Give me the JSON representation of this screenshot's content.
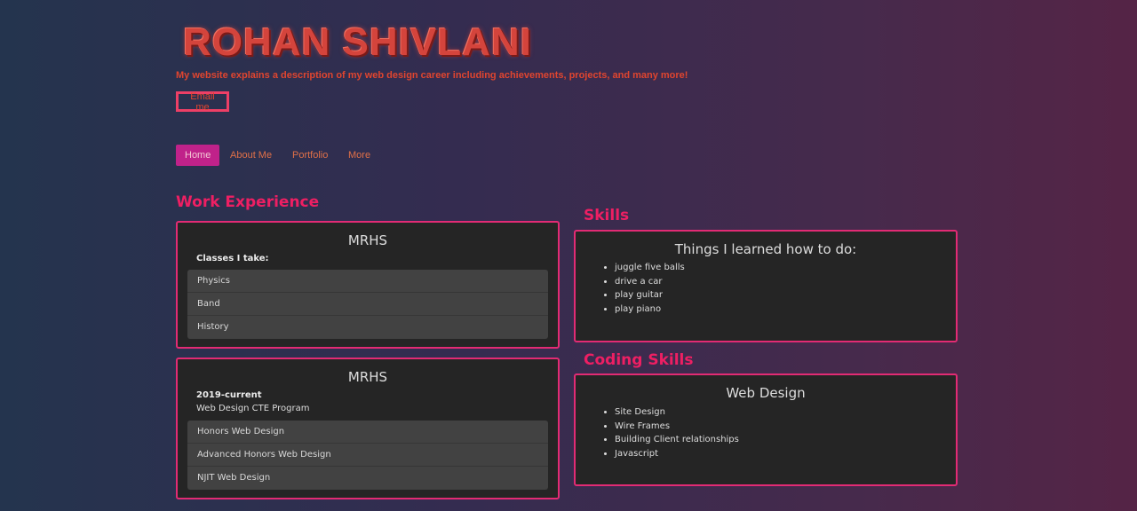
{
  "header": {
    "logo_text": "ROHAN SHIVLANI",
    "tagline": "My website explains a description of my web design career including achievements, projects, and many more!",
    "email_button": "Email me"
  },
  "nav": {
    "items": [
      {
        "label": "Home",
        "active": true
      },
      {
        "label": "About Me",
        "active": false
      },
      {
        "label": "Portfolio",
        "active": false
      },
      {
        "label": "More",
        "active": false
      }
    ]
  },
  "work_experience": {
    "title": "Work Experience",
    "cards": [
      {
        "title": "MRHS",
        "subheading": "Classes I take:",
        "items": [
          "Physics",
          "Band",
          "History"
        ]
      },
      {
        "title": "MRHS",
        "subheading": "2019-current",
        "text": "Web Design CTE Program",
        "items": [
          "Honors Web Design",
          "Advanced Honors Web Design",
          "NJIT Web Design"
        ]
      }
    ]
  },
  "skills": {
    "title": "Skills",
    "card_title": "Things I learned how to do:",
    "items": [
      "juggle five balls",
      "drive a car",
      "play guitar",
      "play piano"
    ]
  },
  "coding_skills": {
    "title": "Coding Skills",
    "card_title": "Web Design",
    "items": [
      "Site Design",
      "Wire Frames",
      "Building Client relationships",
      "Javascript"
    ]
  },
  "colors": {
    "accent_pink": "#ee1f63",
    "card_border": "#e22b74",
    "nav_active": "#c0228a",
    "tagline": "#e0452f",
    "card_bg": "#252525"
  }
}
